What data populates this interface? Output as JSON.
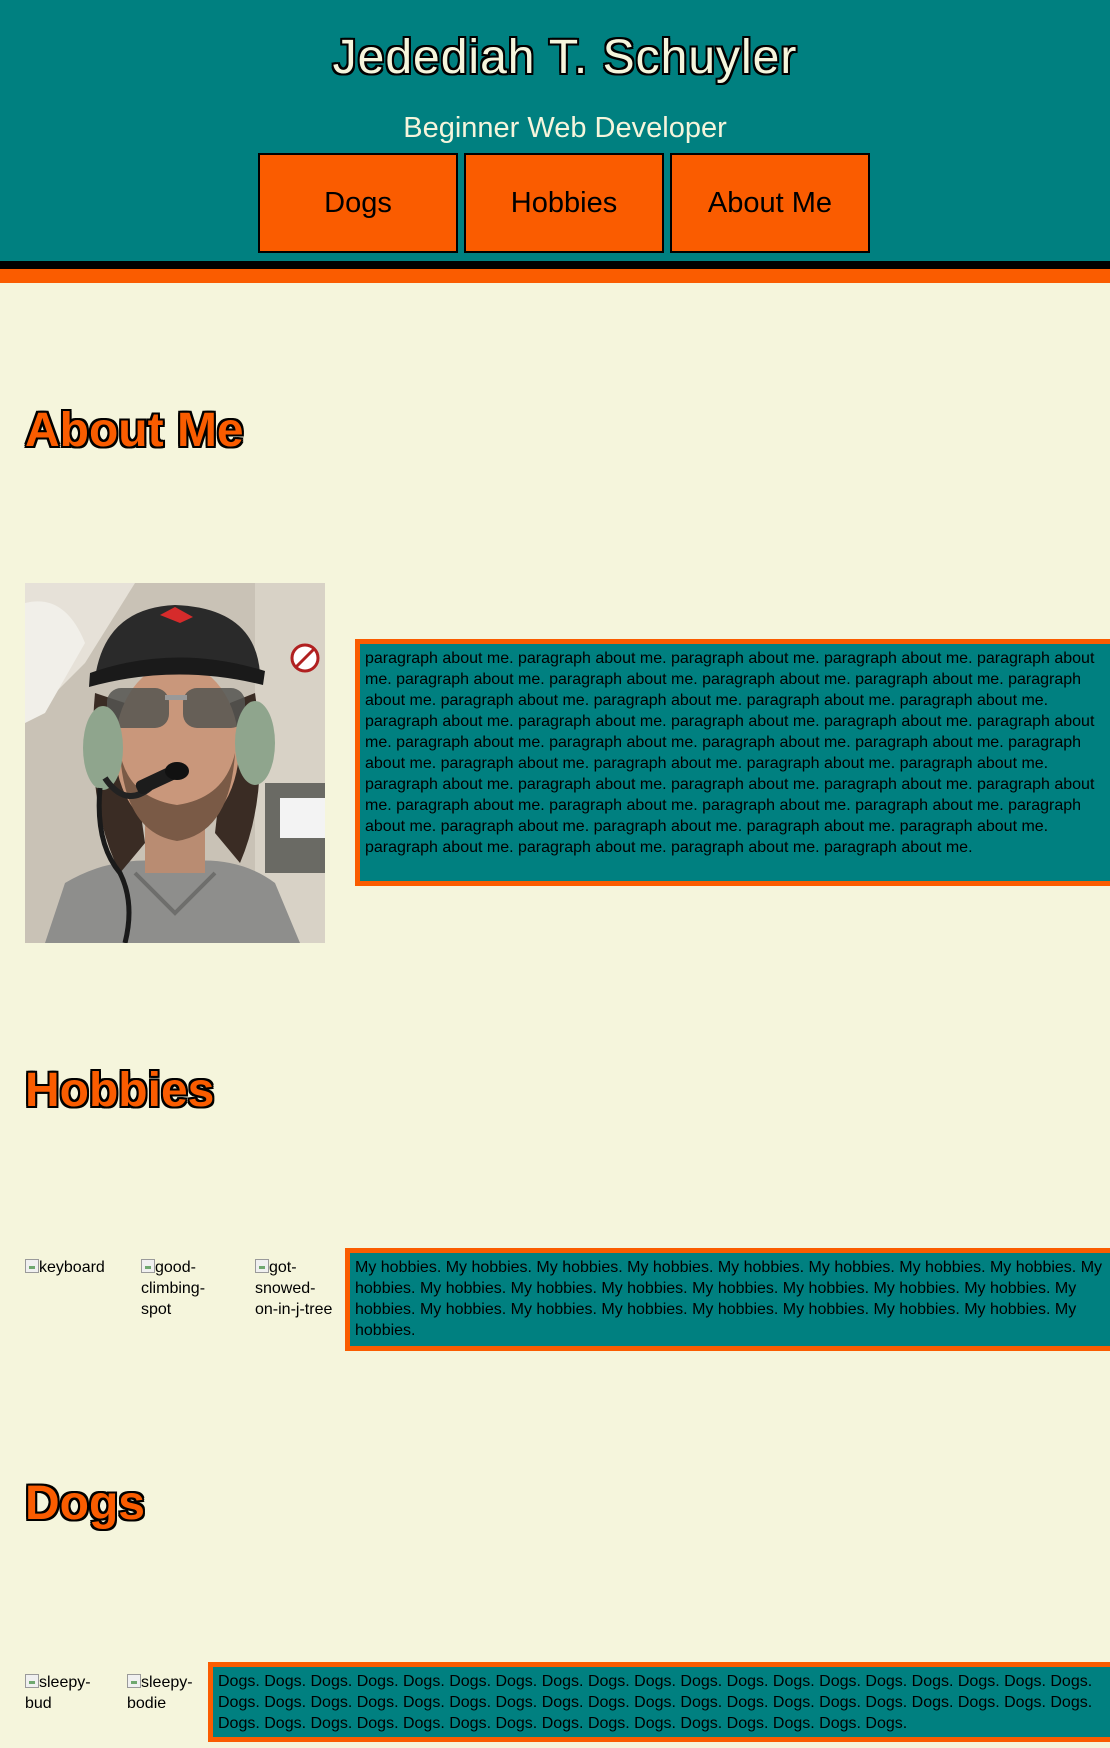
{
  "header": {
    "title": "Jedediah T. Schuyler",
    "subtitle": "Beginner Web Developer"
  },
  "nav": {
    "items": [
      {
        "label": "Dogs"
      },
      {
        "label": "Hobbies"
      },
      {
        "label": "About Me"
      }
    ]
  },
  "about": {
    "heading": "About Me",
    "paragraph": "paragraph about me. paragraph about me. paragraph about me. paragraph about me. paragraph about me. paragraph about me. paragraph about me. paragraph about me. paragraph about me. paragraph about me. paragraph about me. paragraph about me. paragraph about me. paragraph about me. paragraph about me. paragraph about me. paragraph about me. paragraph about me. paragraph about me. paragraph about me. paragraph about me. paragraph about me. paragraph about me. paragraph about me. paragraph about me. paragraph about me. paragraph about me. paragraph about me. paragraph about me. paragraph about me. paragraph about me. paragraph about me. paragraph about me. paragraph about me. paragraph about me. paragraph about me. paragraph about me. paragraph about me. paragraph about me. paragraph about me. paragraph about me. paragraph about me. paragraph about me. paragraph about me. paragraph about me. paragraph about me."
  },
  "hobbies": {
    "heading": "Hobbies",
    "images": [
      {
        "alt": "keyboard"
      },
      {
        "alt": "good-climbing-spot"
      },
      {
        "alt": "got-snowed-on-in-j-tree"
      }
    ],
    "paragraph": "My hobbies. My hobbies. My hobbies. My hobbies. My hobbies. My hobbies. My hobbies. My hobbies. My hobbies. My hobbies. My hobbies. My hobbies. My hobbies. My hobbies. My hobbies. My hobbies. My hobbies. My hobbies. My hobbies. My hobbies. My hobbies. My hobbies. My hobbies. My hobbies. My hobbies."
  },
  "dogs": {
    "heading": "Dogs",
    "images": [
      {
        "alt": "sleepy-bud"
      },
      {
        "alt": "sleepy-bodie"
      }
    ],
    "paragraph": "Dogs. Dogs. Dogs. Dogs. Dogs. Dogs. Dogs. Dogs. Dogs. Dogs. Dogs. Dogs. Dogs. Dogs. Dogs. Dogs. Dogs. Dogs. Dogs. Dogs. Dogs. Dogs. Dogs. Dogs. Dogs. Dogs. Dogs. Dogs. Dogs. Dogs. Dogs. Dogs. Dogs. Dogs. Dogs. Dogs. Dogs. Dogs. Dogs. Dogs. Dogs. Dogs. Dogs. Dogs. Dogs. Dogs. Dogs. Dogs. Dogs. Dogs. Dogs. Dogs. Dogs."
  },
  "colors": {
    "teal": "#008080",
    "orange": "#fa5c00",
    "cream": "#f5f5dc",
    "black": "#000000"
  },
  "icons": {
    "broken_image": "broken-image-icon"
  }
}
